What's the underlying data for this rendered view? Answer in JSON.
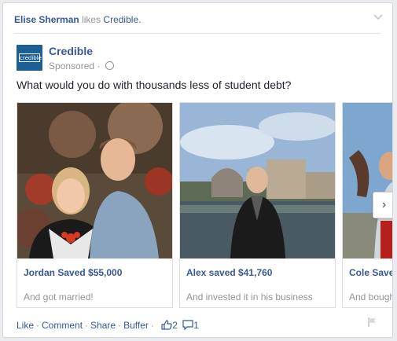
{
  "story": {
    "actor": "Elise Sherman",
    "action": "likes",
    "target": "Credible."
  },
  "post": {
    "page_name": "Credible",
    "logo_text": "credible",
    "sponsored": "Sponsored ·",
    "question": "What would you do with thousands less of student debt?"
  },
  "carousel": {
    "items": [
      {
        "title": "Jordan Saved $55,000",
        "desc": "And got married!"
      },
      {
        "title": "Alex saved $41,760",
        "desc": "And invested it in his business"
      },
      {
        "title": "Cole Saved",
        "desc": "And bought"
      }
    ],
    "next_glyph": "›"
  },
  "actions": {
    "like": "Like",
    "comment": "Comment",
    "share": "Share",
    "buffer": "Buffer",
    "likes_count": "2",
    "comments_count": "1"
  },
  "colors": {
    "link": "#365899",
    "muted": "#90949c",
    "brand": "#1c5f97"
  },
  "icons": [
    "chevron-down-icon",
    "globe-icon",
    "thumbs-up-icon",
    "comment-icon",
    "flag-icon",
    "chevron-right-icon"
  ]
}
